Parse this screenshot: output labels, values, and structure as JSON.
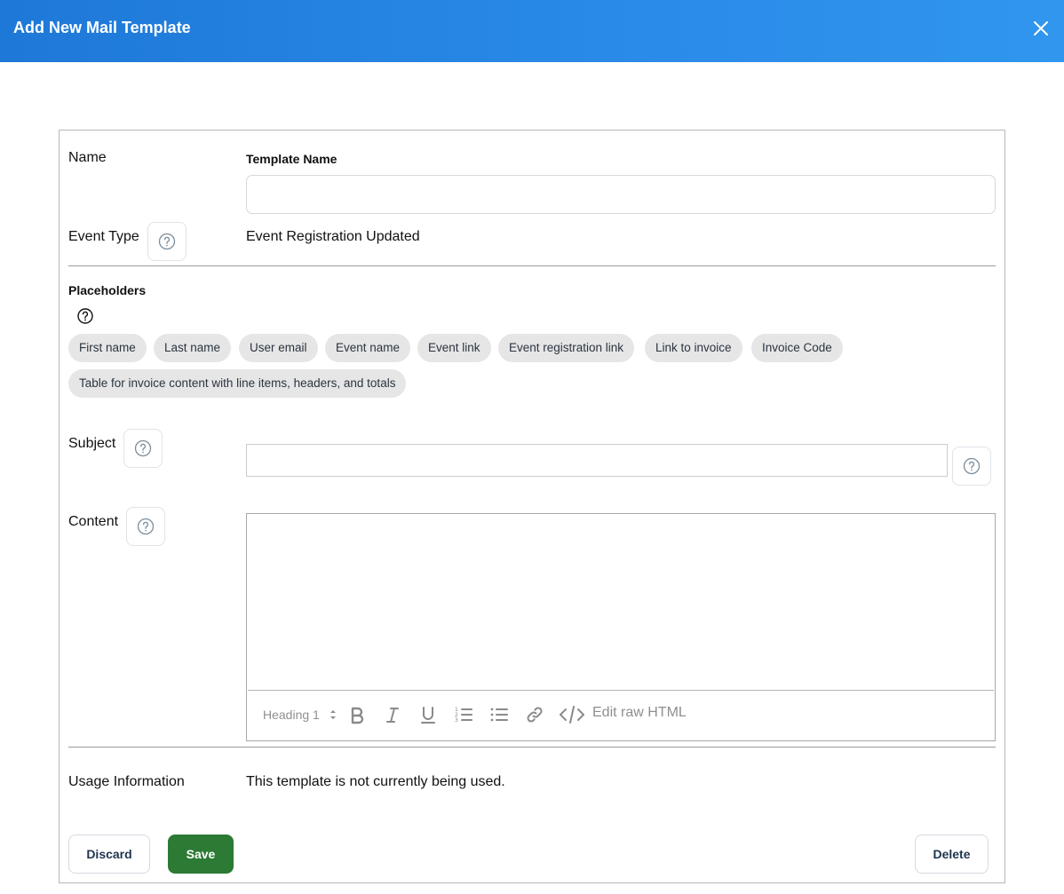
{
  "header": {
    "title": "Add New Mail Template"
  },
  "form": {
    "name_label": "Name",
    "template_name_label": "Template Name",
    "template_name_value": "",
    "event_type_label": "Event Type",
    "event_type_value": "Event Registration Updated",
    "placeholders_label": "Placeholders",
    "placeholders": [
      "First name",
      "Last name",
      "User email",
      "Event name",
      "Event link",
      "Event registration link",
      "Link to invoice",
      "Invoice Code",
      "Table for invoice content with line items, headers, and totals"
    ],
    "subject_label": "Subject",
    "subject_value": "",
    "content_label": "Content",
    "content_value": "",
    "usage_label": "Usage Information",
    "usage_value": "This template is not currently being used."
  },
  "editor_toolbar": {
    "heading_select": "Heading 1",
    "edit_raw_html": "Edit raw HTML",
    "icons": [
      "bold-icon",
      "italic-icon",
      "underline-icon",
      "ordered-list-icon",
      "bullet-list-icon",
      "link-icon",
      "code-icon"
    ]
  },
  "actions": {
    "discard": "Discard",
    "save": "Save",
    "delete": "Delete"
  },
  "colors": {
    "header": "#2a8be8",
    "save": "#2c7a34"
  }
}
